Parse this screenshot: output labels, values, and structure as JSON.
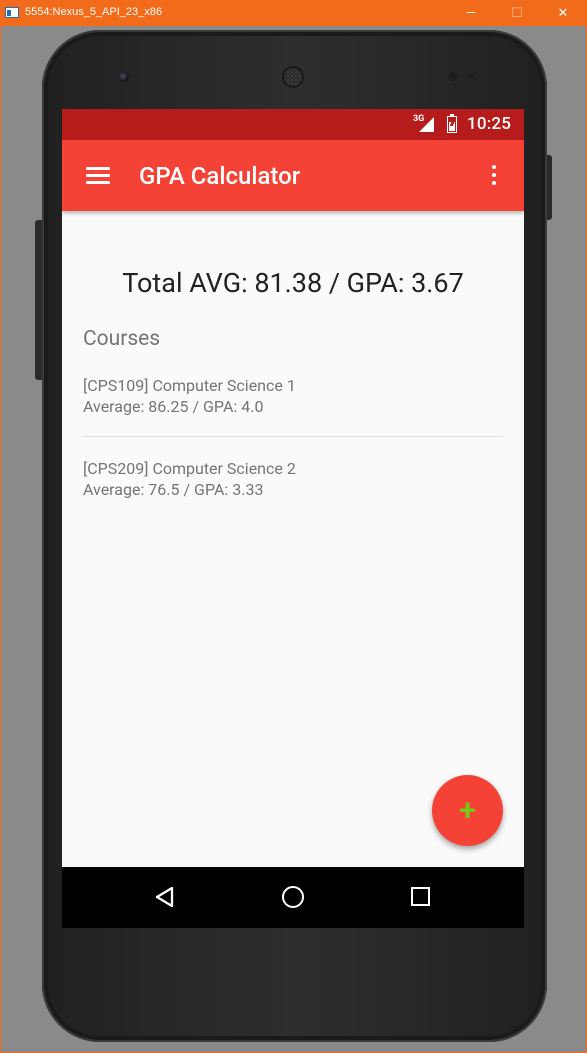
{
  "window": {
    "title": "5554:Nexus_5_API_23_x86",
    "min_glyph": "—",
    "max_glyph": "☐",
    "close_glyph": "✕"
  },
  "status_bar": {
    "network": "3G",
    "time": "10:25"
  },
  "app_bar": {
    "title": "GPA Calculator",
    "menu_icon": "hamburger-menu-icon",
    "overflow_icon": "more-vert-icon",
    "color": "#f44336",
    "status_color": "#b71c1c"
  },
  "summary": {
    "text": "Total AVG: 81.38 / GPA: 3.67"
  },
  "courses": {
    "heading": "Courses",
    "items": [
      {
        "title": "[CPS109] Computer Science 1",
        "detail": "Average: 86.25 / GPA: 4.0"
      },
      {
        "title": "[CPS209] Computer Science 2",
        "detail": "Average: 76.5 / GPA: 3.33"
      }
    ]
  },
  "fab": {
    "label": "+",
    "icon": "add-icon",
    "icon_color": "#7cc61a"
  },
  "nav_bar": {
    "back_icon": "back-triangle-icon",
    "home_icon": "home-circle-icon",
    "recents_icon": "recents-square-icon"
  }
}
